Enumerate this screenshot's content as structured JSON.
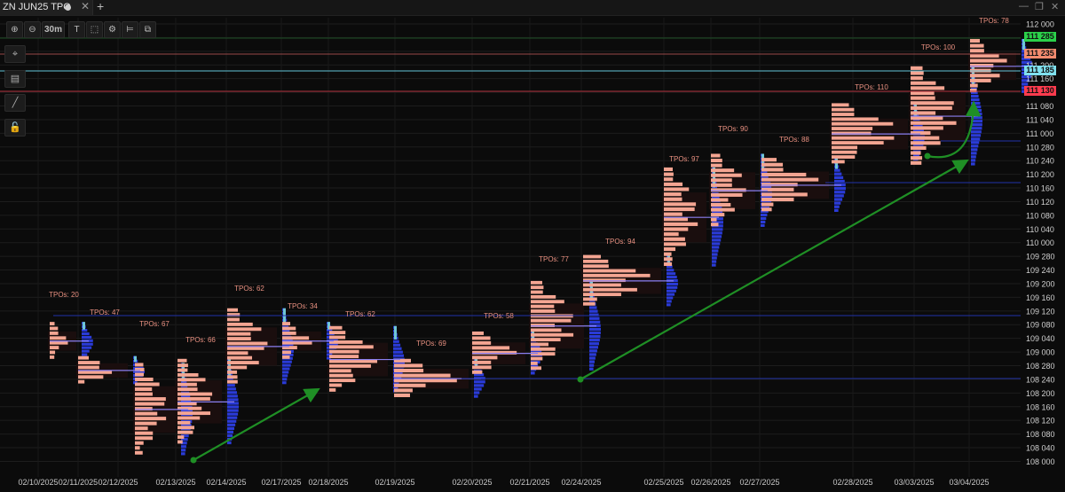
{
  "tab": {
    "title": "ZN JUN25 TPO",
    "close": "✕",
    "add": "+"
  },
  "window": {
    "minimize": "—",
    "restore": "❐",
    "close": "✕"
  },
  "toolbar": {
    "zoom_in": "⊕",
    "zoom_out": "⊖",
    "timeframe": "30m",
    "text_tool": "T",
    "select_tool": "⬚",
    "settings": "⚙",
    "profile_tool": "⊨",
    "copy_tool": "⧉"
  },
  "sidebar": {
    "crosshair": "⌖",
    "notes": "▤",
    "line": "╱",
    "lock": "🔓"
  },
  "price_tags": [
    {
      "value": "111 285",
      "color": "#2bd14a"
    },
    {
      "value": "111 235",
      "color": "#f08a6e"
    },
    {
      "value": "111 185",
      "color": "#7fe0ee"
    },
    {
      "value": "111 130",
      "color": "#ff3b4e"
    }
  ],
  "chart_data": {
    "type": "tpo",
    "y_axis_labels": [
      "112 000",
      "111 280",
      "111 240",
      "111 200",
      "111 160",
      "111 120",
      "111 080",
      "111 040",
      "111 000",
      "110 280",
      "110 240",
      "110 200",
      "110 160",
      "110 120",
      "110 080",
      "110 040",
      "110 000",
      "109 280",
      "109 240",
      "109 200",
      "109 160",
      "109 120",
      "109 080",
      "109 040",
      "109 000",
      "108 280",
      "108 240",
      "108 200",
      "108 160",
      "108 120",
      "108 080",
      "108 040",
      "108 000"
    ],
    "x_axis_labels": [
      "02/10/2025",
      "02/11/2025",
      "02/12/2025",
      "02/13/2025",
      "02/14/2025",
      "02/17/2025",
      "02/18/2025",
      "02/19/2025",
      "02/20/2025",
      "02/21/2025",
      "02/24/2025",
      "02/25/2025",
      "02/26/2025",
      "02/27/2025",
      "02/28/2025",
      "03/03/2025",
      "03/04/2025"
    ],
    "sessions": [
      {
        "label": "TPOs: 20"
      },
      {
        "label": "TPOs: 47"
      },
      {
        "label": "TPOs: 67"
      },
      {
        "label": "TPOs: 66"
      },
      {
        "label": "TPOs: 62"
      },
      {
        "label": "TPOs: 34"
      },
      {
        "label": "TPOs: 62"
      },
      {
        "label": "TPOs: 69"
      },
      {
        "label": "TPOs: 58"
      },
      {
        "label": "TPOs: 77"
      },
      {
        "label": "TPOs: 94"
      },
      {
        "label": "TPOs: 97"
      },
      {
        "label": "TPOs: 90"
      },
      {
        "label": "TPOs: 88"
      },
      {
        "label": "TPOs: 110"
      },
      {
        "label": "TPOs: 100"
      },
      {
        "label": "TPOs: 78"
      }
    ],
    "colors": {
      "tpo": "#f4a592",
      "volume": "#2a3bd8",
      "poc": "#8a7ff0",
      "arrow": "#1f8f25",
      "grid": "#1d1d1d"
    }
  }
}
